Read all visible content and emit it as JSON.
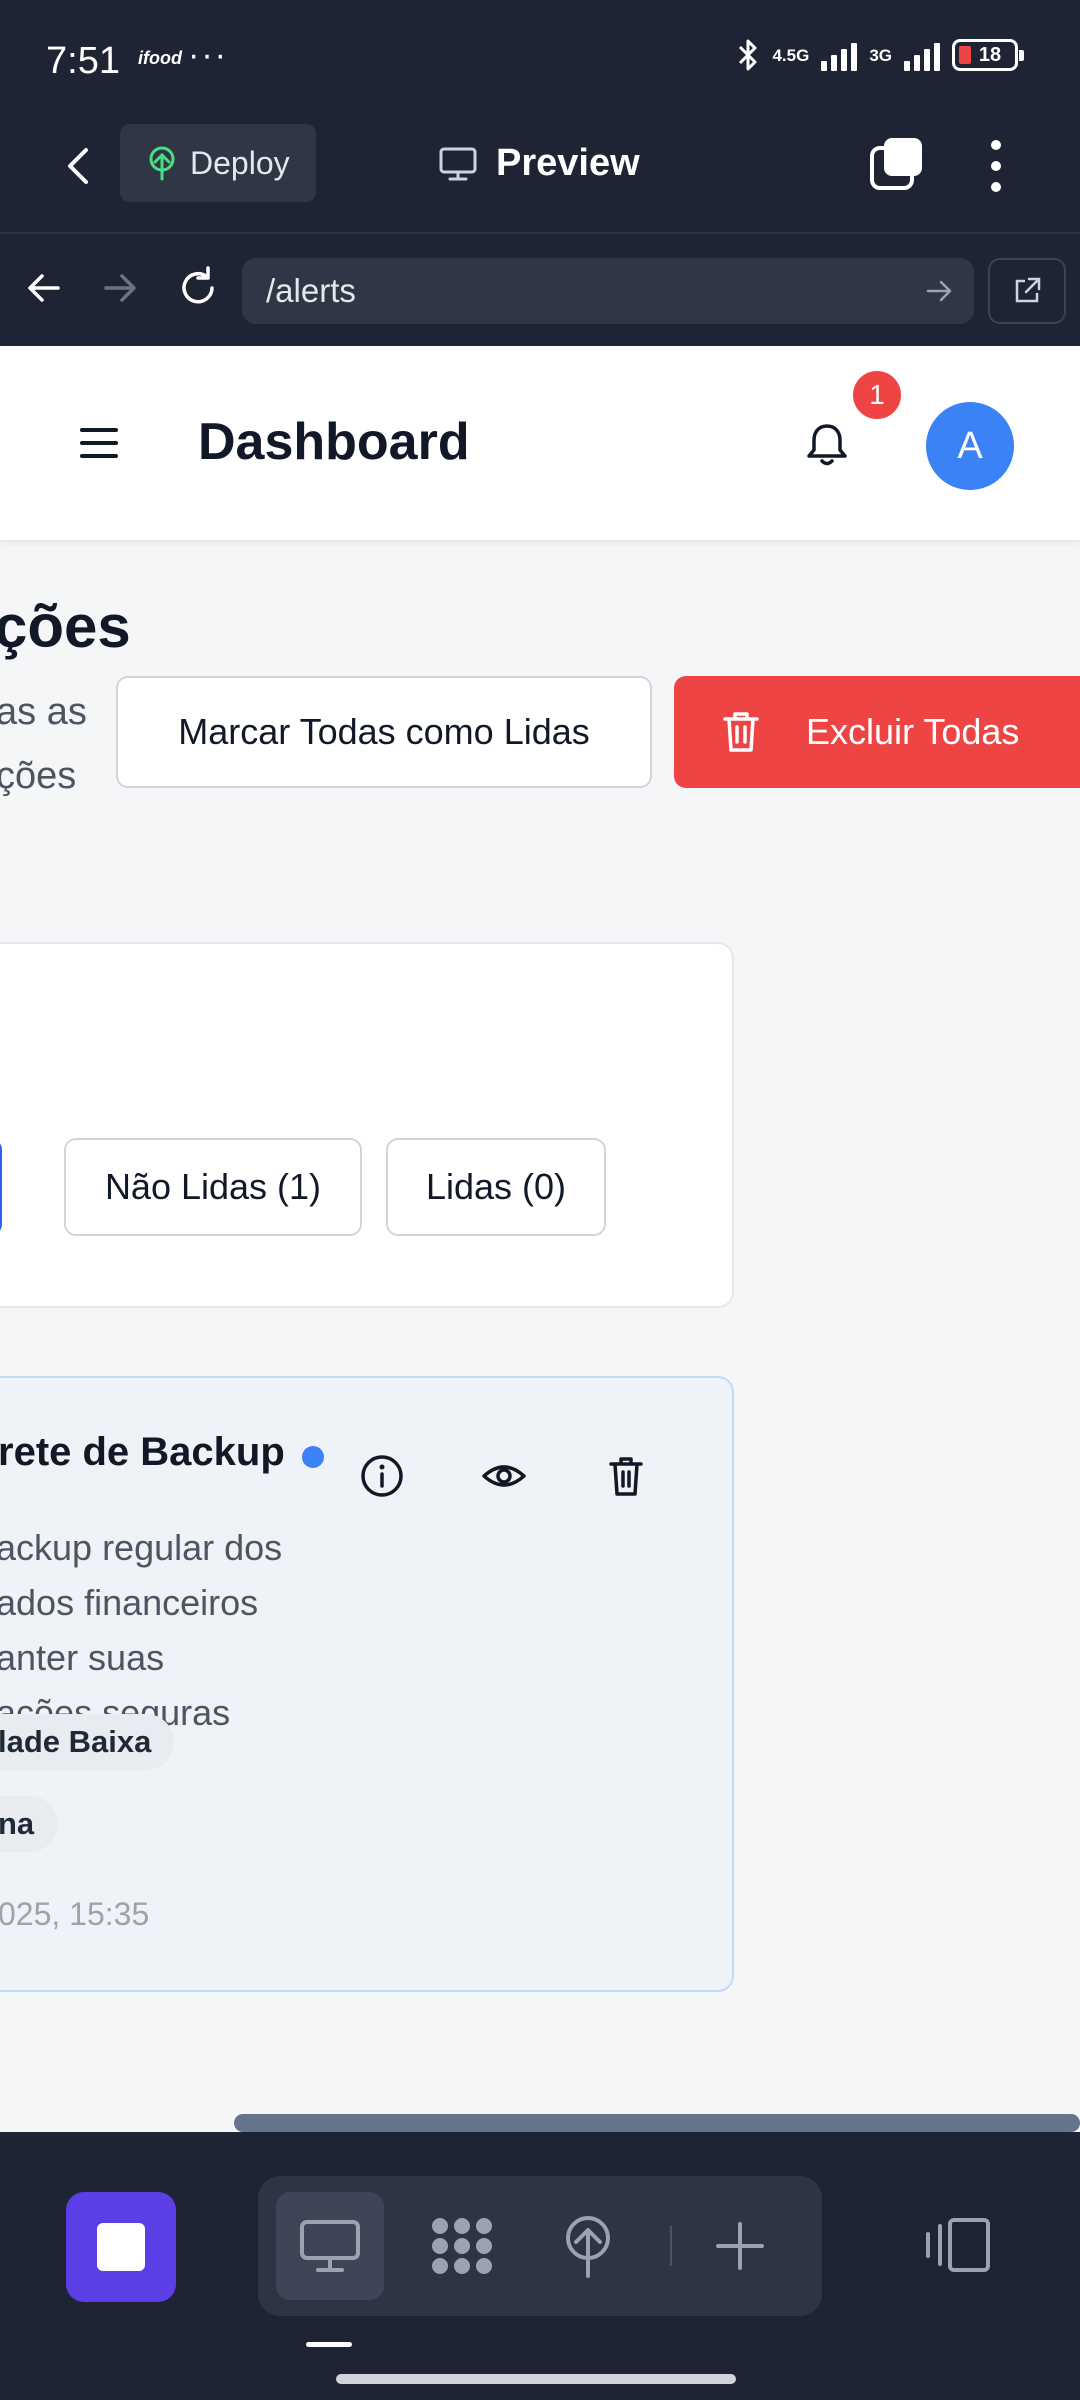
{
  "status_bar": {
    "time": "7:51",
    "app_label": "ifood",
    "dots": "···",
    "network_1": "4.5G",
    "network_2": "3G",
    "battery_level": "18"
  },
  "app_toolbar": {
    "deploy_label": "Deploy",
    "preview_label": "Preview"
  },
  "browser": {
    "url": "/alerts"
  },
  "header": {
    "title": "Dashboard",
    "notification_count": "1",
    "avatar_initial": "A"
  },
  "page": {
    "heading": "ções",
    "description_lines": [
      "as as",
      "ções"
    ],
    "mark_all_label": "Marcar Todas como Lidas",
    "delete_all_label": "Excluir Todas"
  },
  "filters": {
    "all_label": ")",
    "unread_label": "Não Lidas (1)",
    "read_label": "Lidas (0)"
  },
  "alert": {
    "title": "rete de Backup",
    "description_lines": [
      "ackup regular dos",
      "ados financeiros",
      "anter suas",
      "ações seguras"
    ],
    "tag_priority": "lade Baixa",
    "tag_category": "na",
    "time": "025, 15:35"
  },
  "colors": {
    "accent_blue": "#2563eb",
    "danger_red": "#ef4444",
    "purple": "#5b3ee6",
    "dark_bg": "#1e2433"
  }
}
